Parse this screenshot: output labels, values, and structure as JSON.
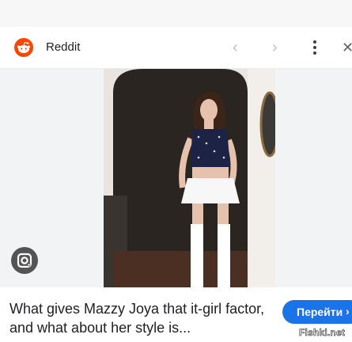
{
  "header": {
    "source_name": "Reddit",
    "prev_icon": "chevron-left-icon",
    "next_icon": "chevron-right-icon",
    "more_icon": "more-vert-icon",
    "close_icon": "close-icon",
    "logo_icon": "reddit-logo-icon"
  },
  "preview": {
    "lens_icon": "google-lens-icon"
  },
  "result": {
    "title": "What gives Mazzy Joya that it-girl factor, and what about her style is...",
    "visit_button_label": "Перейти",
    "visit_arrow": "›"
  },
  "watermark": "Fishki.net",
  "colors": {
    "accent": "#1a73e8",
    "reddit_orange": "#ff4500"
  }
}
